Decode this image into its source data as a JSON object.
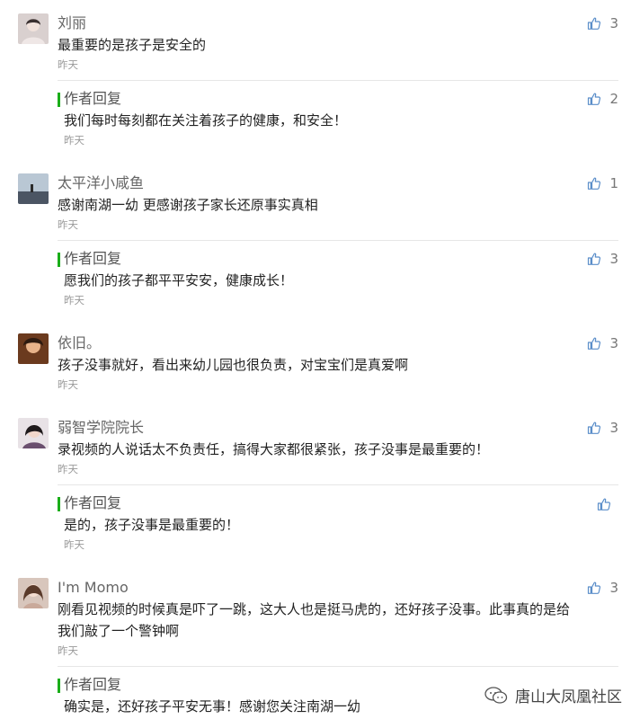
{
  "comments": [
    {
      "name": "刘丽",
      "text": "最重要的是孩子是安全的",
      "time": "昨天",
      "likes": "3",
      "reply": {
        "label": "作者回复",
        "text": "我们每时每刻都在关注着孩子的健康，和安全！",
        "time": "昨天",
        "likes": "2"
      }
    },
    {
      "name": "太平洋小咸鱼",
      "text": "感谢南湖一幼  更感谢孩子家长还原事实真相",
      "time": "昨天",
      "likes": "1",
      "reply": {
        "label": "作者回复",
        "text": "愿我们的孩子都平平安安，健康成长！",
        "time": "昨天",
        "likes": "3"
      }
    },
    {
      "name": "依旧。",
      "text": "孩子没事就好，看出来幼儿园也很负责，对宝宝们是真爱啊",
      "time": "昨天",
      "likes": "3"
    },
    {
      "name": "弱智学院院长",
      "text": "录视频的人说话太不负责任，搞得大家都很紧张，孩子没事是最重要的！",
      "time": "昨天",
      "likes": "3",
      "reply": {
        "label": "作者回复",
        "text": "是的，孩子没事是最重要的！",
        "time": "昨天",
        "likes": ""
      }
    },
    {
      "name": "I'm Momo",
      "text_line1": "刚看见视频的时候真是吓了一跳，这大人也是挺马虎的，还好孩子没事。此事真的是给",
      "text_line2": "我们敲了一个警钟啊",
      "time": "昨天",
      "likes": "3",
      "reply": {
        "label": "作者回复",
        "text": "确实是，还好孩子平安无事！感谢您关注南湖一幼",
        "time": "",
        "likes": ""
      }
    }
  ],
  "watermark": {
    "text": "唐山大凤凰社区",
    "icon": "wechat-icon"
  },
  "colors": {
    "accent": "#1aad19",
    "name": "#666666",
    "time": "#999999"
  }
}
